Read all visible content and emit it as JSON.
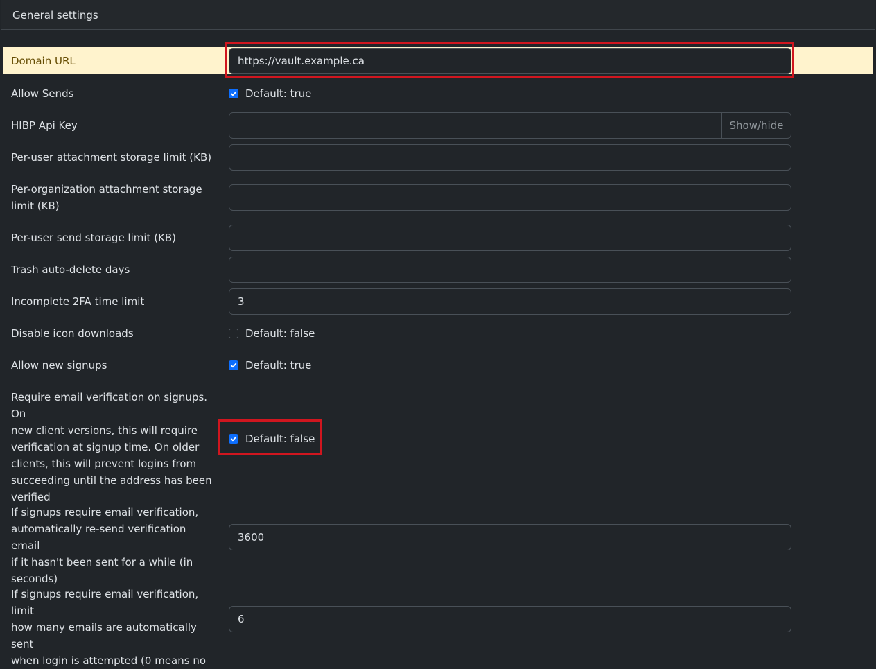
{
  "header": {
    "title": "General settings"
  },
  "settings": {
    "domain_url": {
      "label": "Domain URL",
      "value": "https://vault.example.ca"
    },
    "allow_sends": {
      "label": "Allow Sends",
      "checked": true,
      "hint": "Default: true"
    },
    "hibp_api_key": {
      "label": "HIBP Api Key",
      "value": "",
      "button": "Show/hide"
    },
    "user_attach_limit": {
      "label": "Per-user attachment storage limit (KB)",
      "value": ""
    },
    "org_attach_limit": {
      "label_line1": "Per-organization attachment storage",
      "label_line2": "limit (KB)",
      "value": ""
    },
    "user_send_limit": {
      "label": "Per-user send storage limit (KB)",
      "value": ""
    },
    "trash_days": {
      "label": "Trash auto-delete days",
      "value": ""
    },
    "twofa_limit": {
      "label": "Incomplete 2FA time limit",
      "value": "3"
    },
    "disable_icons": {
      "label": "Disable icon downloads",
      "checked": false,
      "hint": "Default: false"
    },
    "allow_signups": {
      "label": "Allow new signups",
      "checked": true,
      "hint": "Default: true"
    },
    "signup_verify": {
      "label_lines": [
        "Require email verification on signups. On",
        "new client versions, this will require",
        "verification at signup time. On older",
        "clients, this will prevent logins from",
        "succeeding until the address has been",
        "verified"
      ],
      "checked": true,
      "hint": "Default: false"
    },
    "resend_time": {
      "label_lines": [
        "If signups require email verification,",
        "automatically re-send verification email",
        "if it hasn't been sent for a while (in",
        "seconds)"
      ],
      "value": "3600"
    },
    "resend_limit": {
      "label_lines": [
        "If signups require email verification, limit",
        "how many emails are automatically sent",
        "when login is attempted (0 means no"
      ],
      "value": "6"
    }
  },
  "colors": {
    "background": "#212529",
    "highlight": "#fff3cd",
    "checkbox_checked": "#0d6efd",
    "annotation_red": "#d0161f"
  }
}
